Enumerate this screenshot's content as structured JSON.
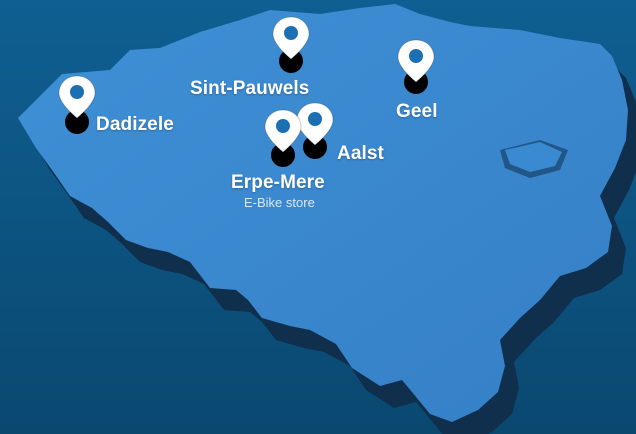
{
  "colors": {
    "background_top": "#0d5a8a",
    "background_bottom": "#0a4a74",
    "map_fill": "#3b8bd2",
    "map_side": "#0f2f4d",
    "pin_fill": "#ffffff",
    "pin_dot": "#000000",
    "label_color": "#ffffff"
  },
  "icons": {
    "marker": "map-pin-icon"
  },
  "locations": [
    {
      "name": "Dadizele",
      "sub": ""
    },
    {
      "name": "Sint-Pauwels",
      "sub": ""
    },
    {
      "name": "Geel",
      "sub": ""
    },
    {
      "name": "Aalst",
      "sub": ""
    },
    {
      "name": "Erpe-Mere",
      "sub": "E-Bike store"
    }
  ]
}
